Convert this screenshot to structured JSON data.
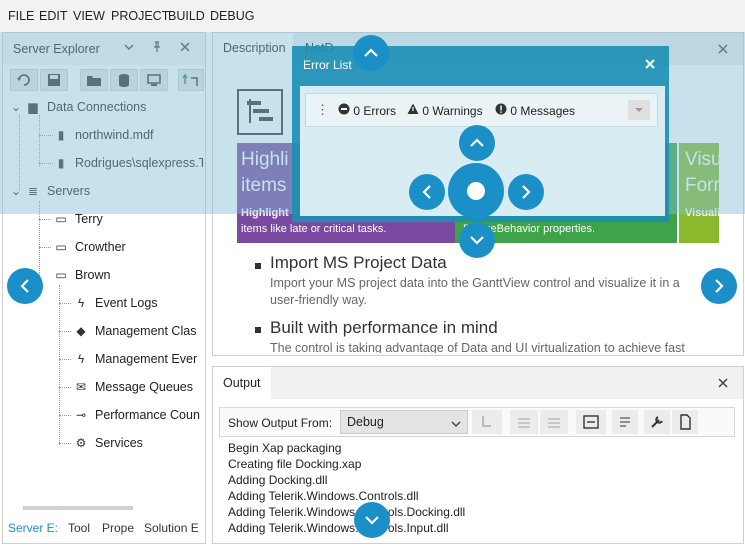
{
  "menu": [
    "FILE",
    "EDIT",
    "VIEW",
    "PROJECT",
    "BUILD",
    "DEBUG"
  ],
  "server_explorer": {
    "title": "Server Explorer",
    "tree": [
      {
        "label": "Data Connections",
        "level": 0
      },
      {
        "label": "northwind.mdf",
        "level": 1
      },
      {
        "label": "Rodrigues\\sqlexpress.Ti",
        "level": 1
      },
      {
        "label": "Servers",
        "level": 0
      },
      {
        "label": "Terry",
        "level": 1
      },
      {
        "label": "Crowther",
        "level": 1
      },
      {
        "label": "Brown",
        "level": 1
      },
      {
        "label": "Event Logs",
        "level": 2
      },
      {
        "label": "Management Clas",
        "level": 2
      },
      {
        "label": "Management Ever",
        "level": 2
      },
      {
        "label": "Message Queues",
        "level": 2
      },
      {
        "label": "Performance Coun",
        "level": 2
      },
      {
        "label": "Services",
        "level": 2
      }
    ]
  },
  "bottom_tabs": [
    "Server E:",
    "Tool",
    "Prope",
    "Solution E"
  ],
  "document": {
    "tabs": [
      "Description",
      "NetD"
    ],
    "tiles": [
      {
        "title_line1": "Highli",
        "title_line2": "items",
        "subtitle": "Highlight",
        "subtitle2": "items like late or critical tasks.",
        "color": "#7a4aa0"
      },
      {
        "subtitle2": "ResizeBehavior properties.",
        "color": "#3fa34a"
      },
      {
        "title_line1": "Visu",
        "title_line2": "Form",
        "subtitle": "Visuali",
        "color": "#8ab92d"
      }
    ],
    "features": [
      {
        "title": "Import MS Project Data",
        "desc_line1": "Import your MS project data into the GanttView control and visualize it in a",
        "desc_line2": "user-friendly way."
      },
      {
        "title": "Built with performance in mind",
        "desc_line1": "The control is taking advantage of Data and UI virtualization to achieve fast"
      }
    ]
  },
  "error_list": {
    "title": "Error List",
    "errors": "0 Errors",
    "warnings": "0 Warnings",
    "messages": "0 Messages"
  },
  "output": {
    "title": "Output",
    "show_label": "Show Output From:",
    "source": "Debug",
    "lines": [
      "Begin Xap packaging",
      "Creating file Docking.xap",
      "Adding Docking.dll",
      "Adding Telerik.Windows.Controls.dll",
      "Adding Telerik.Windows.Controls.Docking.dll",
      "Adding Telerik.Windows.Controls.Input.dll"
    ]
  },
  "icons": {
    "close": "×",
    "chevron_down": "⌄",
    "pin": "⊥",
    "arrow_left": "‹",
    "arrow_right": "›"
  },
  "colors": {
    "accent": "#1b8fc7",
    "overlay": "#2aa6cf"
  }
}
